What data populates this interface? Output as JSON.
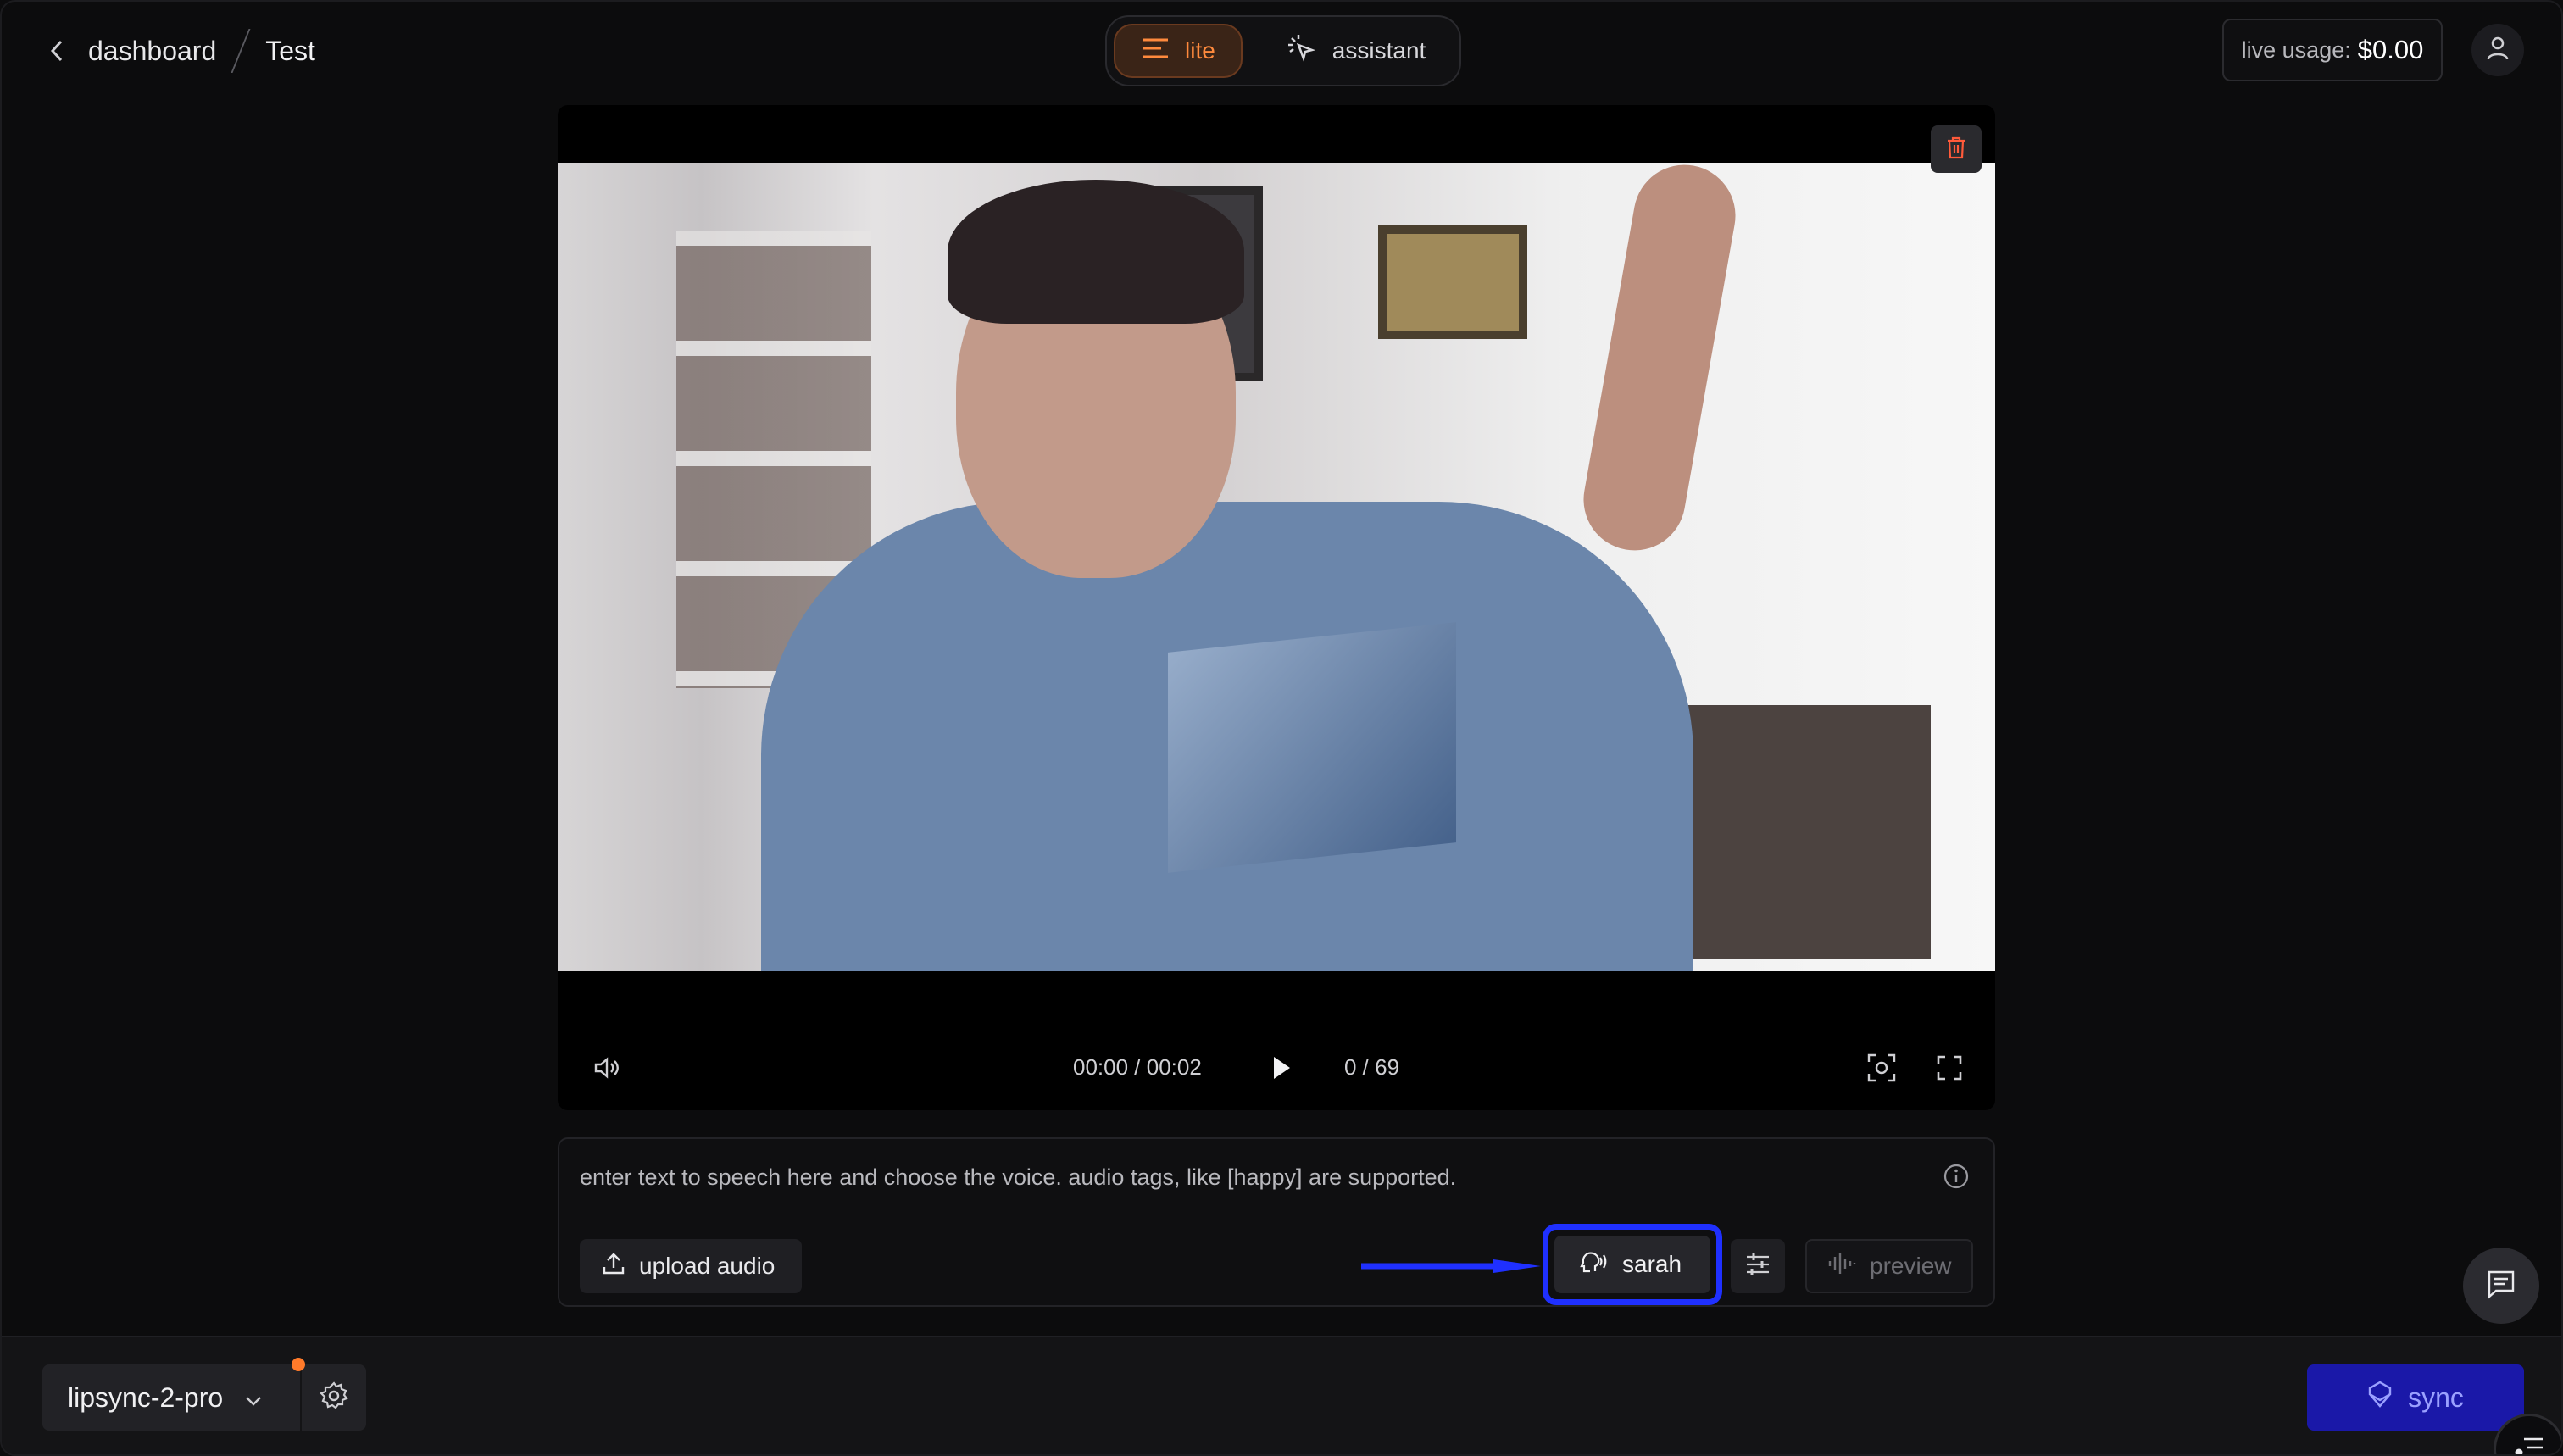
{
  "header": {
    "breadcrumb_parent": "dashboard",
    "breadcrumb_current": "Test",
    "modes": [
      {
        "label": "lite",
        "active": true
      },
      {
        "label": "assistant",
        "active": false
      }
    ],
    "usage_label": "live usage:",
    "usage_value": "$0.00"
  },
  "player": {
    "time": "00:00 / 00:02",
    "frames": "0 / 69"
  },
  "prompt": {
    "placeholder": "enter text to speech here and choose the voice. audio tags, like [happy] are supported.",
    "upload_label": "upload audio",
    "voice_label": "sarah",
    "preview_label": "preview"
  },
  "footer": {
    "model": "lipsync-2-pro",
    "sync_label": "sync"
  },
  "colors": {
    "accent_orange": "#ff8a3d",
    "highlight_blue": "#1f30ff",
    "sync_blue": "#1a18a8"
  }
}
